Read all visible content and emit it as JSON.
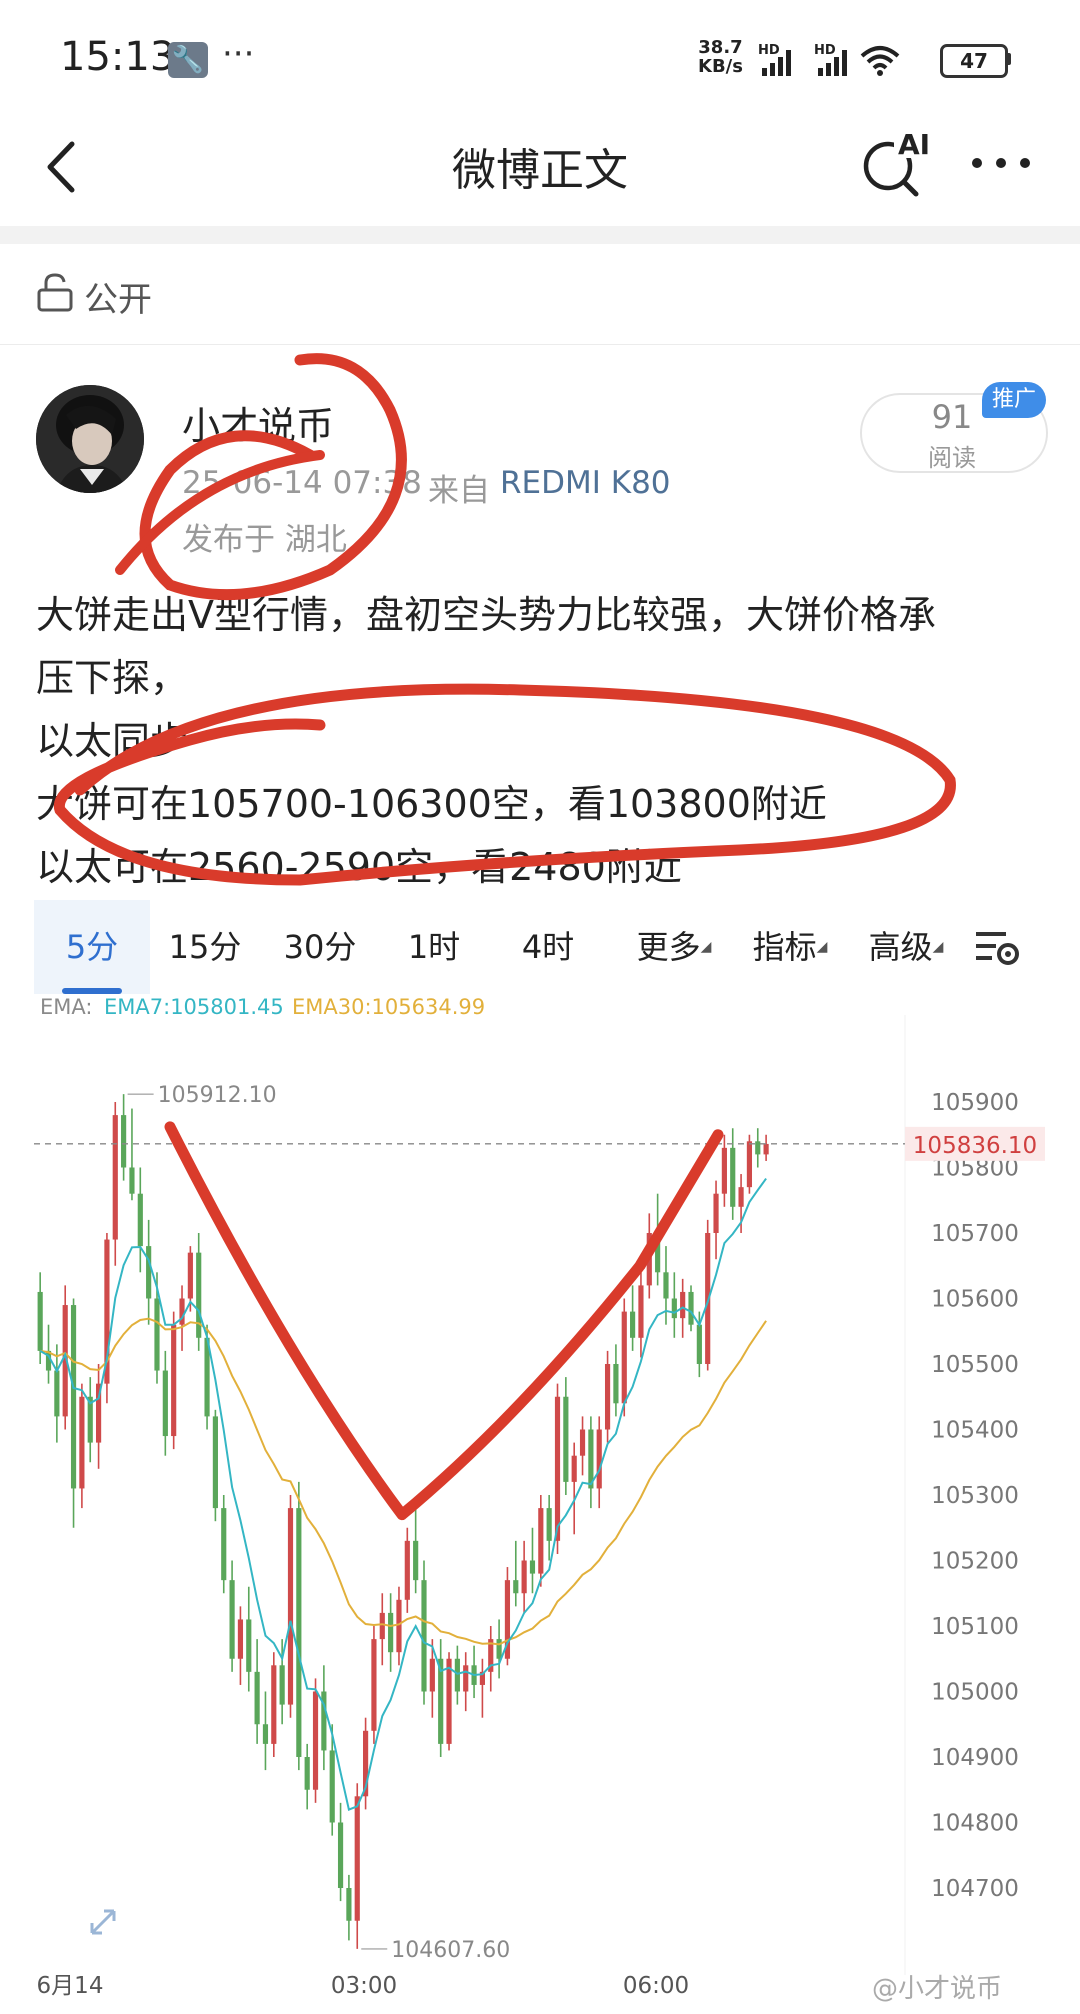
{
  "status_bar": {
    "time": "15:13",
    "net_speed_value": "38.7",
    "net_speed_unit": "KB/s",
    "signal1_label": "HD",
    "signal2_label": "HD",
    "battery": "47",
    "icons": [
      "wrench-icon",
      "more-dots-icon",
      "signal-icon",
      "signal-icon",
      "wifi-icon",
      "battery-icon"
    ]
  },
  "nav": {
    "title": "微博正文",
    "ai_label": "AI",
    "icons": [
      "back-icon",
      "ai-search-icon",
      "more-icon"
    ]
  },
  "visibility": {
    "label": "公开",
    "icon": "lock-icon"
  },
  "post": {
    "author": "小才说币",
    "time": "25-06-14 07:38",
    "source_prefix": "来自",
    "device": "REDMI K80",
    "location": "发布于 湖北",
    "read_count": "91",
    "read_label": "阅读",
    "promo_badge": "推广",
    "lines": [
      "大饼走出V型行情，盘初空头势力比较强，大饼价格承",
      "压下探，",
      "以太同步",
      "大饼可在105700-106300空，看103800附近",
      "以太可在2560-2590空，看2480附近"
    ]
  },
  "chart_tabs": [
    {
      "label": "5分",
      "active": true
    },
    {
      "label": "15分"
    },
    {
      "label": "30分"
    },
    {
      "label": "1时"
    },
    {
      "label": "4时"
    },
    {
      "label": "更多",
      "dropdown": true
    },
    {
      "label": "指标",
      "dropdown": true
    },
    {
      "label": "高级",
      "dropdown": true
    }
  ],
  "chart_settings_icon": "chart-settings-icon",
  "ema": {
    "prefix": "EMA:",
    "ema7": "EMA7:105801.45",
    "ema30": "EMA30:105634.99",
    "ema7_color": "#34b6c4",
    "ema30_color": "#e2b03b"
  },
  "chart_data": {
    "type": "candlestick",
    "y_ticks": [
      "105900",
      "105800",
      "105700",
      "105600",
      "105500",
      "105400",
      "105300",
      "105200",
      "105100",
      "105000",
      "104900",
      "104800",
      "104700"
    ],
    "ylim": [
      104600,
      105960
    ],
    "x_ticks": [
      "6月14",
      "03:00",
      "06:00"
    ],
    "current_price": "105836.10",
    "high_label": "105912.10",
    "low_label": "104607.60",
    "up_color": "#cf4a4a",
    "down_color": "#5aa65a",
    "grid": false,
    "candles_ohlc": [
      [
        105610,
        105640,
        105500,
        105520
      ],
      [
        105520,
        105560,
        105470,
        105490
      ],
      [
        105490,
        105530,
        105380,
        105420
      ],
      [
        105420,
        105620,
        105400,
        105590
      ],
      [
        105590,
        105600,
        105250,
        105310
      ],
      [
        105310,
        105470,
        105280,
        105450
      ],
      [
        105450,
        105480,
        105350,
        105380
      ],
      [
        105380,
        105500,
        105340,
        105470
      ],
      [
        105470,
        105700,
        105440,
        105690
      ],
      [
        105690,
        105900,
        105650,
        105880
      ],
      [
        105880,
        105912,
        105780,
        105800
      ],
      [
        105800,
        105890,
        105750,
        105760
      ],
      [
        105760,
        105800,
        105640,
        105680
      ],
      [
        105680,
        105720,
        105560,
        105600
      ],
      [
        105600,
        105640,
        105470,
        105490
      ],
      [
        105490,
        105520,
        105360,
        105390
      ],
      [
        105390,
        105580,
        105370,
        105560
      ],
      [
        105560,
        105620,
        105520,
        105600
      ],
      [
        105600,
        105680,
        105580,
        105670
      ],
      [
        105670,
        105700,
        105520,
        105540
      ],
      [
        105540,
        105560,
        105400,
        105420
      ],
      [
        105420,
        105430,
        105260,
        105280
      ],
      [
        105280,
        105300,
        105150,
        105170
      ],
      [
        105170,
        105200,
        105030,
        105050
      ],
      [
        105050,
        105130,
        105010,
        105110
      ],
      [
        105110,
        105160,
        105000,
        105030
      ],
      [
        105030,
        105080,
        104920,
        104950
      ],
      [
        104950,
        105000,
        104880,
        104920
      ],
      [
        104920,
        105060,
        104900,
        105040
      ],
      [
        105040,
        105080,
        104950,
        104980
      ],
      [
        104980,
        105300,
        104960,
        105280
      ],
      [
        105280,
        105320,
        104880,
        104900
      ],
      [
        104900,
        104920,
        104820,
        104850
      ],
      [
        104850,
        105020,
        104830,
        105000
      ],
      [
        105000,
        105040,
        104880,
        104910
      ],
      [
        104910,
        104950,
        104780,
        104800
      ],
      [
        104800,
        104830,
        104680,
        104700
      ],
      [
        104700,
        104720,
        104620,
        104650
      ],
      [
        104650,
        104860,
        104607,
        104840
      ],
      [
        104840,
        104960,
        104820,
        104940
      ],
      [
        104940,
        105100,
        104920,
        105080
      ],
      [
        105080,
        105150,
        105040,
        105120
      ],
      [
        105120,
        105150,
        105030,
        105060
      ],
      [
        105060,
        105160,
        105040,
        105140
      ],
      [
        105140,
        105250,
        105120,
        105230
      ],
      [
        105230,
        105280,
        105150,
        105170
      ],
      [
        105170,
        105200,
        104980,
        105000
      ],
      [
        105000,
        105080,
        104960,
        105050
      ],
      [
        105050,
        105080,
        104900,
        104920
      ],
      [
        104920,
        105060,
        104910,
        105050
      ],
      [
        105050,
        105070,
        104980,
        105000
      ],
      [
        105000,
        105060,
        104970,
        105040
      ],
      [
        105040,
        105070,
        104990,
        105010
      ],
      [
        105010,
        105050,
        104960,
        105030
      ],
      [
        105030,
        105100,
        105000,
        105080
      ],
      [
        105080,
        105110,
        105020,
        105050
      ],
      [
        105050,
        105190,
        105040,
        105170
      ],
      [
        105170,
        105230,
        105130,
        105150
      ],
      [
        105150,
        105230,
        105120,
        105200
      ],
      [
        105200,
        105250,
        105150,
        105180
      ],
      [
        105180,
        105300,
        105160,
        105280
      ],
      [
        105280,
        105300,
        105200,
        105230
      ],
      [
        105230,
        105470,
        105210,
        105450
      ],
      [
        105450,
        105480,
        105300,
        105320
      ],
      [
        105320,
        105380,
        105240,
        105360
      ],
      [
        105360,
        105420,
        105330,
        105400
      ],
      [
        105400,
        105420,
        105280,
        105310
      ],
      [
        105310,
        105420,
        105280,
        105400
      ],
      [
        105400,
        105520,
        105380,
        105500
      ],
      [
        105500,
        105530,
        105420,
        105440
      ],
      [
        105440,
        105600,
        105420,
        105580
      ],
      [
        105580,
        105620,
        105520,
        105540
      ],
      [
        105540,
        105640,
        105510,
        105620
      ],
      [
        105620,
        105730,
        105600,
        105700
      ],
      [
        105700,
        105760,
        105620,
        105640
      ],
      [
        105640,
        105680,
        105560,
        105600
      ],
      [
        105600,
        105640,
        105540,
        105570
      ],
      [
        105570,
        105630,
        105540,
        105610
      ],
      [
        105610,
        105620,
        105550,
        105560
      ],
      [
        105560,
        105580,
        105480,
        105500
      ],
      [
        105500,
        105720,
        105490,
        105700
      ],
      [
        105700,
        105780,
        105660,
        105760
      ],
      [
        105760,
        105850,
        105740,
        105830
      ],
      [
        105830,
        105860,
        105720,
        105740
      ],
      [
        105740,
        105790,
        105700,
        105770
      ],
      [
        105770,
        105850,
        105760,
        105840
      ],
      [
        105840,
        105860,
        105800,
        105820
      ],
      [
        105820,
        105850,
        105810,
        105836
      ]
    ]
  },
  "watermark": "@小才说币"
}
